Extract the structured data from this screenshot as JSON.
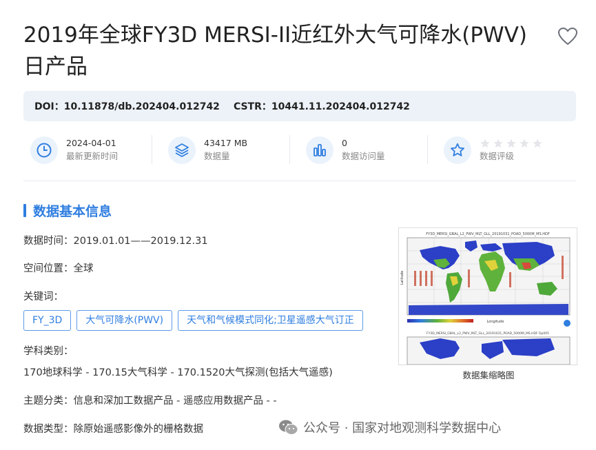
{
  "page": {
    "title": "2019年全球FY3D MERSI-II近红外大气可降水(PWV)日产品"
  },
  "ids": {
    "doi": "DOI：10.11878/db.202404.012742",
    "cstr": "CSTR：10441.11.202404.012742"
  },
  "stats": [
    {
      "icon": "clock-icon",
      "value": "2024-04-01",
      "label": "最新更新时间"
    },
    {
      "icon": "layers-icon",
      "value": "43417 MB",
      "label": "数据量"
    },
    {
      "icon": "bar-chart-icon",
      "value": "0",
      "label": "数据访问量"
    },
    {
      "icon": "star-icon",
      "value": "",
      "label": "数据评级",
      "rating": 0,
      "max_rating": 5
    }
  ],
  "basic_info": {
    "section_title": "数据基本信息",
    "time": "数据时间：2019.01.01——2019.12.31",
    "location": "空间位置：全球",
    "keywords_label": "关键词：",
    "keywords": [
      "FY_3D",
      "大气可降水(PWV)",
      "天气和气候模式同化;卫星遥感大气订正"
    ],
    "discipline_label": "学科类别：",
    "discipline": "170地球科学 - 170.15大气科学 - 170.1520大气探测(包括大气遥感)",
    "topic": "主题分类：信息和深加工数据产品 - 遥感应用数据产品 - -",
    "data_type": "数据类型：除原始遥感影像外的栅格数据"
  },
  "thumbnail": {
    "caption": "数据集缩略图",
    "map_title_1": "FY3D_MERSI_GBAL_L2_PWV_MLT_GLL_20191031_POAD_5000M_MS.HDF",
    "map_title_2": "FY3D_MERSI_GBAL_L2_PWV_MLT_GLL_20191031_POAD_5000M_MS.HDF Dp005",
    "ylabel": "Latitude",
    "xlabel": "Longitude"
  },
  "watermark": {
    "text": "公众号 · 国家对地观测科学数据中心"
  },
  "colors": {
    "accent": "#2f7ee0",
    "doi_bg": "#edf2f8",
    "icon_bg": "#eaf2fc"
  }
}
